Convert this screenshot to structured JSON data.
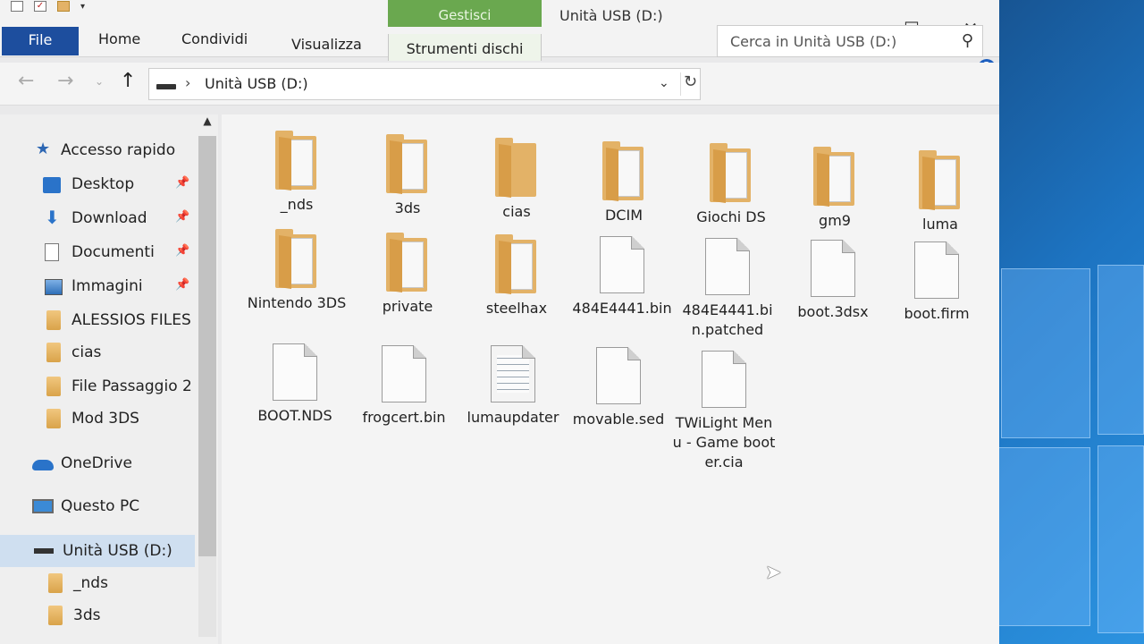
{
  "window": {
    "title": "Unità USB (D:)",
    "context_tab": "Gestisci",
    "controls": {
      "minimize": "—",
      "maximize": "☐",
      "close": "✕"
    }
  },
  "ribbon": {
    "tabs": [
      "File",
      "Home",
      "Condividi",
      "Visualizza"
    ],
    "context_tool": "Strumenti dischi",
    "help": "?"
  },
  "address": {
    "path": "Unità USB (D:)",
    "separator": "›"
  },
  "search": {
    "placeholder": "Cerca in Unità USB (D:)"
  },
  "sidebar": {
    "items": [
      {
        "label": "Accesso rapido",
        "icon": "star-icon"
      },
      {
        "label": "Desktop",
        "icon": "desktop-icon",
        "pinned": true
      },
      {
        "label": "Download",
        "icon": "download-icon",
        "pinned": true
      },
      {
        "label": "Documenti",
        "icon": "document-icon",
        "pinned": true
      },
      {
        "label": "Immagini",
        "icon": "pictures-icon",
        "pinned": true
      },
      {
        "label": "ALESSIOS FILES",
        "icon": "folder-icon"
      },
      {
        "label": "cias",
        "icon": "folder-icon"
      },
      {
        "label": "File Passaggio 2",
        "icon": "folder-icon"
      },
      {
        "label": "Mod 3DS",
        "icon": "folder-icon"
      },
      {
        "label": "OneDrive",
        "icon": "cloud-icon"
      },
      {
        "label": "Questo PC",
        "icon": "pc-icon"
      },
      {
        "label": "Unità USB (D:)",
        "icon": "usb-drive-icon",
        "selected": true
      },
      {
        "label": "_nds",
        "icon": "folder-icon"
      },
      {
        "label": "3ds",
        "icon": "folder-icon"
      }
    ]
  },
  "files": [
    {
      "name": "_nds",
      "type": "folder"
    },
    {
      "name": "3ds",
      "type": "folder"
    },
    {
      "name": "cias",
      "type": "folder"
    },
    {
      "name": "DCIM",
      "type": "folder"
    },
    {
      "name": "Giochi DS",
      "type": "folder"
    },
    {
      "name": "gm9",
      "type": "folder"
    },
    {
      "name": "luma",
      "type": "folder"
    },
    {
      "name": "Nintendo 3DS",
      "type": "folder"
    },
    {
      "name": "private",
      "type": "folder"
    },
    {
      "name": "steelhax",
      "type": "folder"
    },
    {
      "name": "484E4441.bin",
      "type": "file"
    },
    {
      "name": "484E4441.bin.patched",
      "type": "file"
    },
    {
      "name": "boot.3dsx",
      "type": "file"
    },
    {
      "name": "boot.firm",
      "type": "file"
    },
    {
      "name": "BOOT.NDS",
      "type": "file"
    },
    {
      "name": "frogcert.bin",
      "type": "file"
    },
    {
      "name": "lumaupdater",
      "type": "text-file"
    },
    {
      "name": "movable.sed",
      "type": "file"
    },
    {
      "name": "TWiLight Menu - Game booter.cia",
      "type": "file"
    }
  ]
}
